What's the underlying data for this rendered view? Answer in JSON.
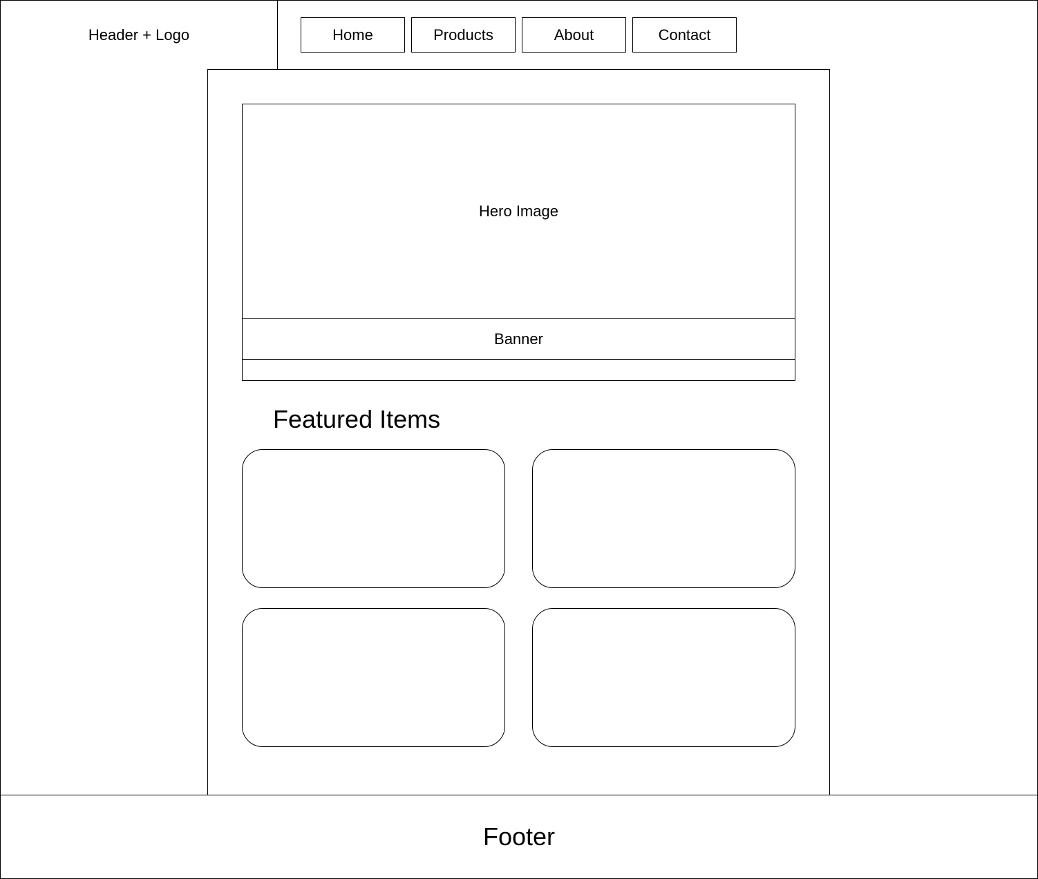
{
  "header": {
    "logo_label": "Header + Logo"
  },
  "nav": {
    "items": [
      {
        "label": "Home"
      },
      {
        "label": "Products"
      },
      {
        "label": "About"
      },
      {
        "label": "Contact"
      }
    ]
  },
  "main": {
    "hero_label": "Hero Image",
    "banner_label": "Banner",
    "featured_title": "Featured Items",
    "featured_card_count": 4
  },
  "footer": {
    "label": "Footer"
  }
}
